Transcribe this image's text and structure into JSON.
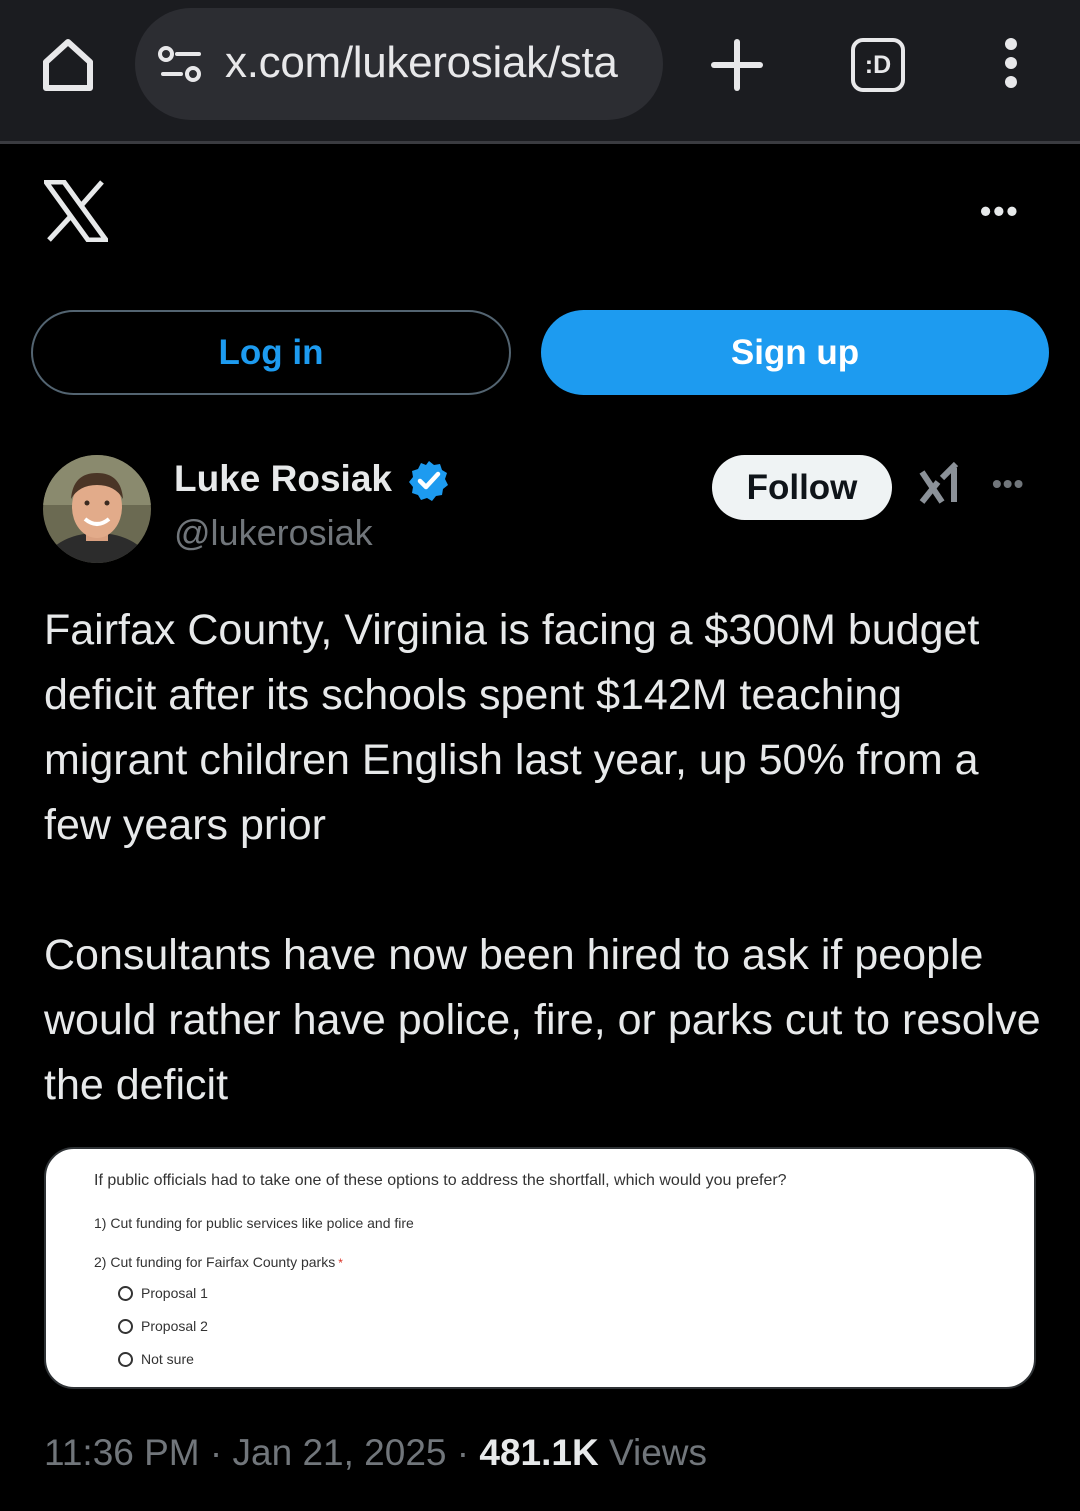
{
  "browser": {
    "url": "x.com/lukerosiak/sta",
    "tabs_label": ":D"
  },
  "header": {
    "more": "•••"
  },
  "auth": {
    "login_label": "Log in",
    "signup_label": "Sign up"
  },
  "tweet": {
    "author_name": "Luke Rosiak",
    "author_handle": "@lukerosiak",
    "follow_label": "Follow",
    "more": "•••",
    "paragraph_1": "Fairfax County, Virginia is facing a $300M budget deficit after its schools spent $142M teaching migrant children English last year, up 50% from a few years prior",
    "paragraph_2": "Consultants have now been hired to ask if people would rather have police, fire, or parks cut to resolve the deficit",
    "media": {
      "question": "If public officials had to take one of these options to address the shortfall, which would you prefer?",
      "option_1": "1) Cut funding for public services like police and fire",
      "option_2": "2) Cut funding for Fairfax County parks",
      "required_marker": "*",
      "choices": [
        "Proposal 1",
        "Proposal 2",
        "Not sure"
      ]
    },
    "time": "11:36 PM",
    "date": "Jan 21, 2025",
    "separator": "·",
    "views_count": "481.1K",
    "views_label": "Views"
  },
  "colors": {
    "background": "#000000",
    "accent": "#1d9bf0",
    "verified": "#1d9bf0",
    "muted_text": "#71767b",
    "text": "#e7e9ea"
  },
  "icons": [
    "home-icon",
    "site-settings-icon",
    "new-tab-icon",
    "tab-switcher-icon",
    "browser-menu-icon",
    "x-logo-icon",
    "verified-badge-icon",
    "grok-icon"
  ]
}
